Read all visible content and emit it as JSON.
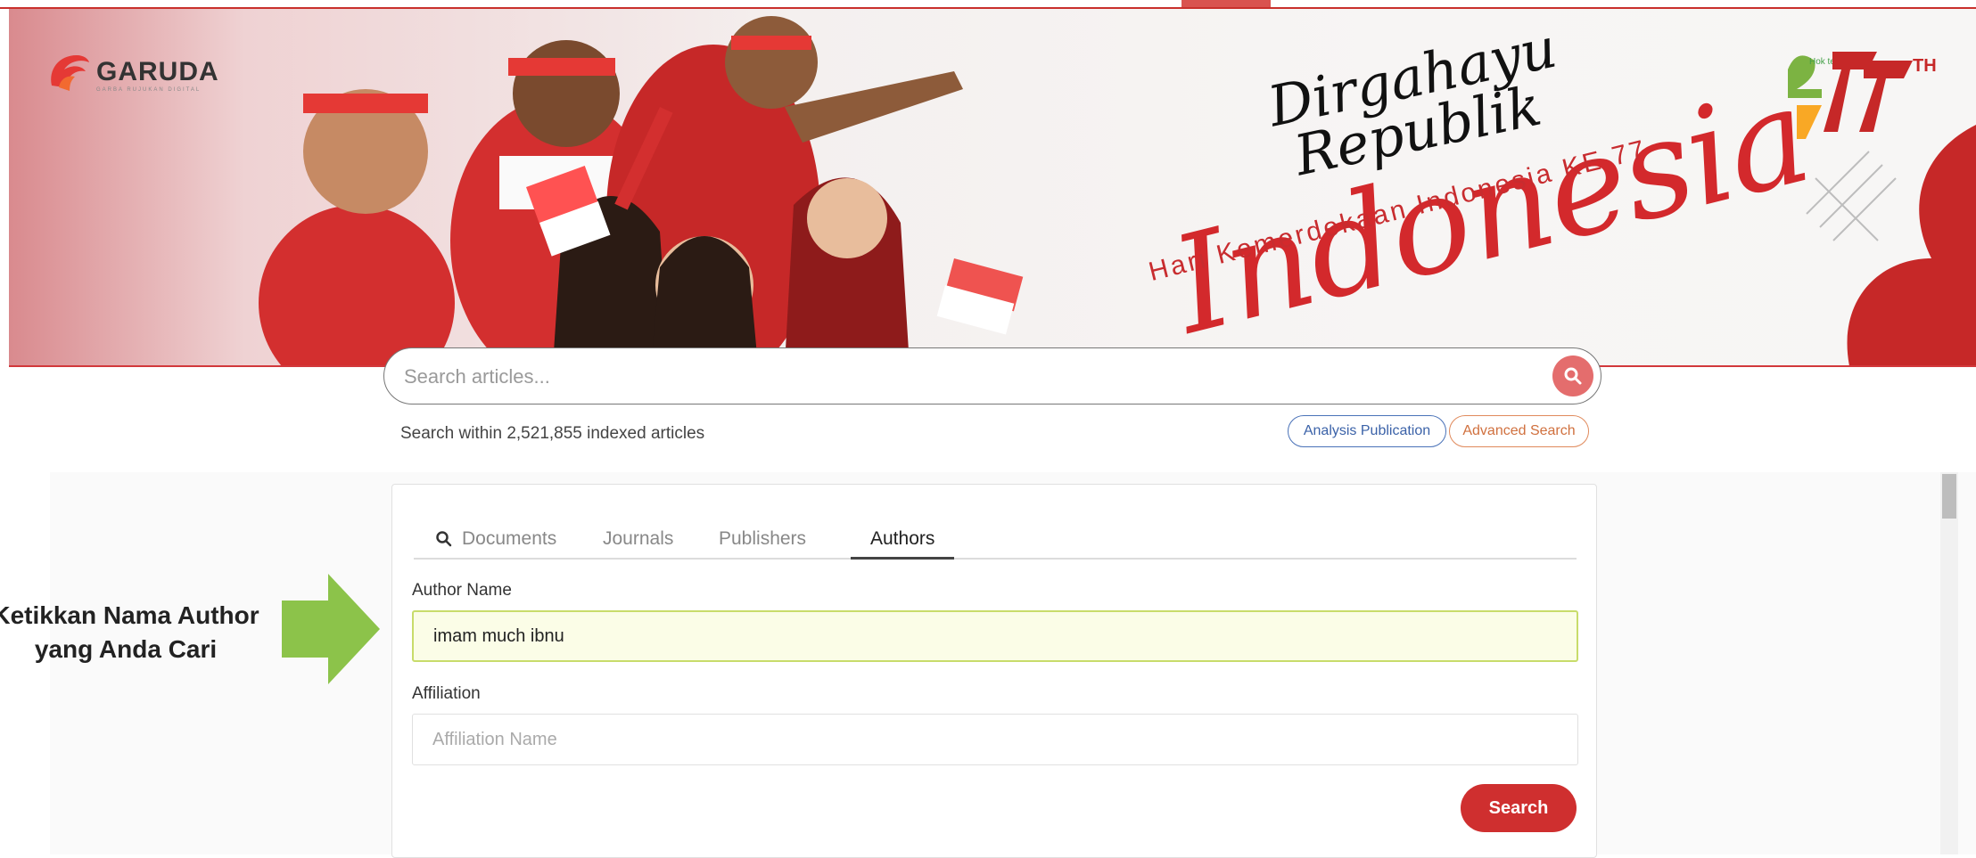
{
  "slide_header": {
    "cut_text": "Ketikkan Nama Author yang Anda Cari"
  },
  "banner": {
    "brand_name": "GARUDA",
    "brand_tagline": "GARBA RUJUKAN DIGITAL",
    "title_line1": "Dirgahayu",
    "title_line2": "Republik",
    "title_main": "Indonesia",
    "subtitle": "Hari Kemerdekaan Indonesia KE 77",
    "anniversary_badge": "77",
    "anniversary_suffix": "TH",
    "badge_small_text": "Hok tek ndo"
  },
  "search": {
    "placeholder": "Search articles...",
    "index_text": "Search within 2,521,855 indexed articles",
    "analysis_label": "Analysis Publication",
    "advanced_label": "Advanced Search"
  },
  "annotation": {
    "line1": "Ketikkan Nama Author",
    "line2": "yang Anda Cari"
  },
  "tabs": [
    {
      "label": "Documents",
      "active": false
    },
    {
      "label": "Journals",
      "active": false
    },
    {
      "label": "Publishers",
      "active": false
    },
    {
      "label": "Authors",
      "active": true
    }
  ],
  "form": {
    "author_label": "Author Name",
    "author_value": "imam much ibnu",
    "affiliation_label": "Affiliation",
    "affiliation_placeholder": "Affiliation Name",
    "submit_label": "Search"
  },
  "colors": {
    "brand_red": "#cf2f2f",
    "search_icon_bg": "#e46d6d",
    "analysis_blue": "#3b62a8",
    "advanced_orange": "#d0703e",
    "arrow_green": "#8cc34a",
    "author_field_bg": "#fbfde7"
  }
}
